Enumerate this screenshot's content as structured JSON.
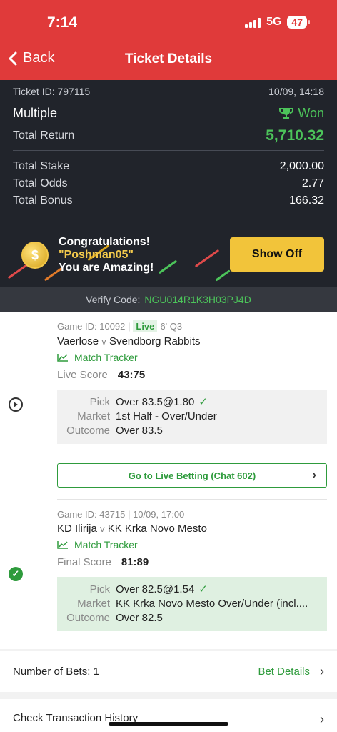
{
  "status_bar": {
    "time": "7:14",
    "network": "5G",
    "battery": "47"
  },
  "nav": {
    "back_label": "Back",
    "title": "Ticket Details"
  },
  "ticket": {
    "id_label": "Ticket ID: 797115",
    "datetime": "10/09, 14:18",
    "type": "Multiple",
    "result": "Won",
    "total_return_label": "Total Return",
    "total_return": "5,710.32",
    "stake_label": "Total Stake",
    "stake": "2,000.00",
    "odds_label": "Total Odds",
    "odds": "2.77",
    "bonus_label": "Total Bonus",
    "bonus": "166.32"
  },
  "promo": {
    "line1": "Congratulations!",
    "line2": "\"Poshman05\"",
    "line3": "You are Amazing!",
    "button": "Show Off"
  },
  "verify": {
    "label": "Verify Code:",
    "code": "NGU014R1K3H03PJ4D"
  },
  "bets": [
    {
      "game_id": "Game ID: 10092 |",
      "live": "Live",
      "time_info": "6' Q3",
      "home": "Vaerlose",
      "v": "v",
      "away": "Svendborg Rabbits",
      "tracker": "Match Tracker",
      "score_label": "Live Score",
      "score": "43:75",
      "pick_label": "Pick",
      "pick": "Over 83.5@1.80",
      "market_label": "Market",
      "market": "1st Half - Over/Under",
      "outcome_label": "Outcome",
      "outcome": "Over 83.5",
      "live_button": "Go to Live Betting (Chat 602)"
    },
    {
      "game_id": "Game ID: 43715 | 10/09, 17:00",
      "home": "KD Ilirija",
      "v": "v",
      "away": "KK Krka Novo Mesto",
      "tracker": "Match Tracker",
      "score_label": "Final Score",
      "score": "81:89",
      "pick_label": "Pick",
      "pick": "Over 82.5@1.54",
      "market_label": "Market",
      "market": "KK Krka Novo Mesto Over/Under (incl....",
      "outcome_label": "Outcome",
      "outcome": "Over 82.5"
    }
  ],
  "footer": {
    "num_bets_label": "Number of Bets: 1",
    "bet_details": "Bet Details",
    "history": "Check Transaction History"
  },
  "colors": {
    "header_red": "#e03a3a",
    "dark_bg": "#21242b",
    "accent_green": "#4cc45a",
    "button_yellow": "#f2c43a"
  }
}
